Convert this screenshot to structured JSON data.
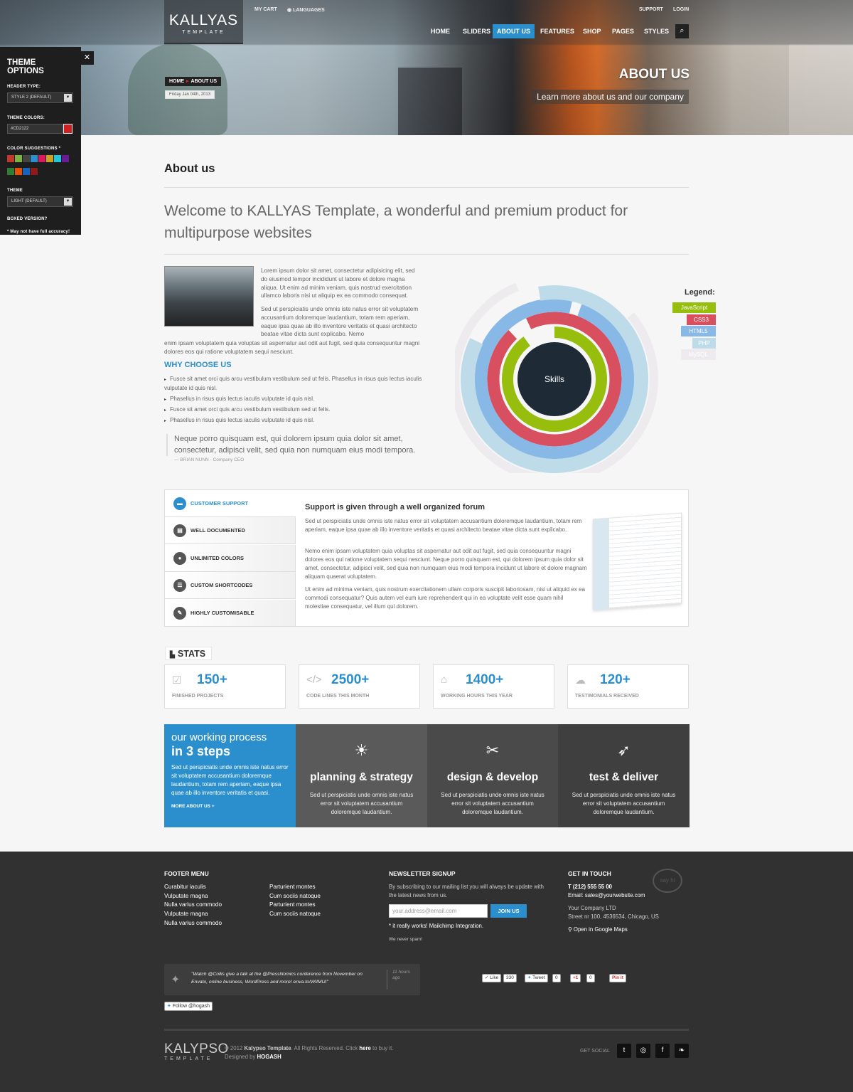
{
  "header": {
    "logo_main": "KALLYAS",
    "logo_sub": "TEMPLATE",
    "top_links": {
      "cart": "MY CART",
      "languages": "LANGUAGES",
      "support": "SUPPORT",
      "login": "LOGIN"
    },
    "nav": [
      "HOME",
      "SLIDERS",
      "ABOUT US",
      "FEATURES",
      "SHOP",
      "PAGES",
      "STYLES"
    ],
    "active_nav": "ABOUT US",
    "breadcrumb": [
      "HOME",
      "ABOUT US"
    ],
    "date": "Friday Jan 04th, 2013",
    "title": "ABOUT US",
    "subtitle": "Learn more about us and our company"
  },
  "theme_panel": {
    "title": "THEME OPTIONS",
    "header_type_label": "HEADER TYPE:",
    "header_type_value": "STYLE 2 (DEFAULT)",
    "theme_colors_label": "THEME COLORS:",
    "theme_color_value": "#CD2122",
    "suggestions_label": "COLOR SUGGESTIONS *",
    "swatches": [
      "#c0392b",
      "#7cb342",
      "#444444",
      "#2c8fcd",
      "#d81b60",
      "#c9a227",
      "#26c6da",
      "#6a1b9a",
      "#2e7d32",
      "#e65100",
      "#1565c0",
      "#8e1b1b"
    ],
    "theme_label": "THEME",
    "theme_value": "LIGHT (DEFAULT)",
    "boxed_label": "BOXED VERSION?",
    "note": "* May not have full accuracy!",
    "close": "✕"
  },
  "content": {
    "page_title": "About us",
    "welcome": "Welcome to KALLYAS Template, a wonderful and premium product for multipurpose websites",
    "p1": "Lorem ipsum dolor sit amet, consectetur adipisicing elit, sed do eiusmod tempor incididunt ut labore et dolore magna aliqua. Ut enim ad minim veniam, quis nostrud exercitation ullamco laboris nisi ut aliquip ex ea commodo consequat.",
    "p2a": "Sed ut perspiciatis unde omnis iste natus error sit voluptatem accusantium doloremque laudantium, totam rem aperiam, eaque ipsa quae ab illo inventore veritatis et quasi architecto beatae vitae dicta sunt explicabo. Nemo",
    "p2b": "enim ipsam voluptatem quia voluptas sit aspernatur aut odit aut fugit, sed quia consequuntur magni dolores eos qui ratione voluptatem sequi nesciunt.",
    "why_title": "WHY CHOOSE US",
    "why_items": [
      "Fusce sit amet orci quis arcu vestibulum vestibulum sed ut felis. Phasellus in risus quis lectus iaculis vulputate id quis nisl.",
      "Phasellus in risus quis lectus iaculis vulputate id quis nisl.",
      "Fusce sit amet orci quis arcu vestibulum vestibulum sed ut felis.",
      "Phasellus in risus quis lectus iaculis vulputate id quis nisl."
    ],
    "quote": "Neque porro quisquam est, qui dolorem ipsum quia dolor sit amet, consectetur, adipisci velit, sed quia non numquam eius modi tempora.",
    "quote_author": "— BRIAN NUNN - Company CEO"
  },
  "skills": {
    "center_label": "Skills",
    "legend_title": "Legend:",
    "items": [
      {
        "name": "JavaScript",
        "color": "#97be0d",
        "fraction": 0.9
      },
      {
        "name": "CSS3",
        "color": "#d84f5f",
        "fraction": 0.95
      },
      {
        "name": "HTML5",
        "color": "#88b8e6",
        "fraction": 0.98
      },
      {
        "name": "PHP",
        "color": "#bedbe9",
        "fraction": 0.85
      },
      {
        "name": "MySQL",
        "color": "#edebee",
        "fraction": 0.8
      }
    ]
  },
  "tabs": {
    "items": [
      {
        "label": "CUSTOMER SUPPORT",
        "icon": "chat-icon",
        "glyph": "▬"
      },
      {
        "label": "WELL DOCUMENTED",
        "icon": "document-icon",
        "glyph": "▤"
      },
      {
        "label": "UNLIMITED COLORS",
        "icon": "drop-icon",
        "glyph": "●"
      },
      {
        "label": "CUSTOM SHORTCODES",
        "icon": "list-icon",
        "glyph": "☰"
      },
      {
        "label": "HIGHLY CUSTOMISABLE",
        "icon": "wrench-icon",
        "glyph": "✎"
      }
    ],
    "active": "CUSTOMER SUPPORT",
    "heading": "Support is given through a well organized forum",
    "p1": "Sed ut perspiciatis unde omnis iste natus error sit voluptatem accusantium doloremque laudantium, totam rem aperiam, eaque ipsa quae ab illo inventore veritatis et quasi architecto beatae vitae dicta sunt explicabo.",
    "p2": "Nemo enim ipsam voluptatem quia voluptas sit aspernatur aut odit aut fugit, sed quia consequuntur magni dolores eos qui ratione voluptatem sequi nesciunt. Neque porro quisquam est, qui dolorem ipsum quia dolor sit amet, consectetur, adipisci velit, sed quia non numquam eius modi tempora incidunt ut labore et dolore magnam aliquam quaerat voluptatem.",
    "p3": "Ut enim ad minima veniam, quis nostrum exercitationem ullam corporis suscipit laboriosam, nisi ut aliquid ex ea commodi consequatur? Quis autem vel eum iure reprehenderit qui in ea voluptate velit esse quam nihil molestiae consequatur, vel illum qui dolorem."
  },
  "stats": {
    "title": "STATS",
    "items": [
      {
        "value": "150+",
        "label": "FINISHED PROJECTS",
        "icon": "checkbox-icon",
        "glyph": "☑"
      },
      {
        "value": "2500+",
        "label": "CODE LINES THIS MONTH",
        "icon": "code-icon",
        "glyph": "</>"
      },
      {
        "value": "1400+",
        "label": "WORKING HOURS THIS YEAR",
        "icon": "lamp-icon",
        "glyph": "⌂"
      },
      {
        "value": "120+",
        "label": "TESTIMONIALS RECEIVED",
        "icon": "speech-bubbles-icon",
        "glyph": "☁"
      }
    ]
  },
  "process": {
    "intro_line1": "our working process",
    "intro_line2": "in 3 steps",
    "intro_text": "Sed ut perspiciatis unde omnis iste natus error sit voluptatem accusantium doloremque laudantium, totam rem aperiam, eaque ipsa quae ab illo inventore veritatis et quasi.",
    "intro_link": "MORE ABOUT US +",
    "steps": [
      {
        "title": "planning & strategy",
        "text": "Sed ut perspiciatis unde omnis iste natus error sit voluptatem accusantium doloremque laudantium.",
        "icon": "lightbulb-icon",
        "glyph": "☀",
        "color": "#5a5a5a"
      },
      {
        "title": "design & develop",
        "text": "Sed ut perspiciatis unde omnis iste natus error sit voluptatem accusantium doloremque laudantium.",
        "icon": "tools-icon",
        "glyph": "✂",
        "color": "#4a4a4a"
      },
      {
        "title": "test & deliver",
        "text": "Sed ut perspiciatis unde omnis iste natus error sit voluptatem accusantium doloremque laudantium.",
        "icon": "rocket-icon",
        "glyph": "➶",
        "color": "#3f3f3f"
      }
    ]
  },
  "footer": {
    "menu_title": "FOOTER MENU",
    "menu_col1": [
      "Curabitur iaculis",
      "Vulputate magna",
      "Nulla varius commodo",
      "Vulputate magna",
      "Nulla varius commodo"
    ],
    "menu_col2": [
      "Parturient montes",
      "Cum sociis natoque",
      "Parturient montes",
      "Cum sociis natoque"
    ],
    "newsletter_title": "NEWSLETTER SIGNUP",
    "newsletter_text": "By subscribing to our mailing list you will always be update with the latest news from us.",
    "newsletter_placeholder": "your.address@email.com",
    "newsletter_button": "JOIN US",
    "newsletter_note": "* it really works! Mailchimp Integration.",
    "newsletter_spam": "We never spam!",
    "contact_title": "GET IN TOUCH",
    "phone": "T (212) 555 55 00",
    "email": "Email: sales@yourwebsite.com",
    "company": "Your Company LTD",
    "address": "Street nr 100, 4536534, Chicago, US",
    "maps": "Open in Google Maps",
    "say_hi": "say hi",
    "tweet": "\"Watch @Collis give a talk at the @PressNomics conference from November on Envato, online business, WordPress and more! enva.to/WIIMUI\"",
    "tweet_time": "11 hours ago",
    "follow": "Follow @hogash",
    "social_buttons": {
      "like": "Like",
      "like_count": "330",
      "tweet": "Tweet",
      "tweet_count": "0",
      "plus": "+1",
      "plus_count": "0",
      "pin": "Pin it"
    },
    "logo_main": "KALYPSO",
    "logo_sub": "TEMPLATE",
    "copyright_a": "© 2012 ",
    "copyright_b": "Kalypso Template",
    "copyright_c": ". All Rights Reserved. Click ",
    "copyright_d": "here",
    "copyright_e": " to buy it.",
    "designed_by": "Designed by ",
    "designer": "HOGASH",
    "get_social": "GET SOCIAL",
    "social_icons": [
      {
        "icon": "twitter-icon",
        "glyph": "t"
      },
      {
        "icon": "dribbble-icon",
        "glyph": "◎"
      },
      {
        "icon": "facebook-icon",
        "glyph": "f"
      },
      {
        "icon": "leaf-icon",
        "glyph": "❧"
      }
    ]
  }
}
